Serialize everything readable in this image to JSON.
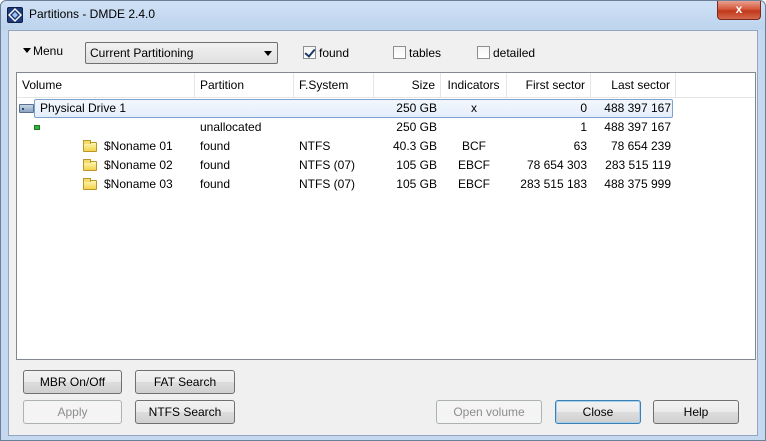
{
  "window": {
    "title": "Partitions - DMDE 2.4.0",
    "close_glyph": "x"
  },
  "toolbar": {
    "menu_label": "Menu",
    "view_select": {
      "selected": "Current Partitioning"
    },
    "checkboxes": [
      {
        "label": "found",
        "checked": true
      },
      {
        "label": "tables",
        "checked": false
      },
      {
        "label": "detailed",
        "checked": false
      }
    ]
  },
  "table": {
    "columns": [
      "Volume",
      "Partition",
      "F.System",
      "Size",
      "Indicators",
      "First sector",
      "Last sector"
    ],
    "rows": [
      {
        "icon": "drive-icon",
        "volume": "Physical Drive 1",
        "partition": "",
        "fs": "",
        "size": "250 GB",
        "indicators": "x",
        "first": "0",
        "last": "488 397 167",
        "selected": true
      },
      {
        "icon": "unallocated-icon",
        "volume": "",
        "partition": "unallocated",
        "fs": "",
        "size": "250 GB",
        "indicators": "",
        "first": "1",
        "last": "488 397 167"
      },
      {
        "icon": "folder-icon",
        "volume": "$Noname 01",
        "partition": "found",
        "fs": "NTFS",
        "size": "40.3 GB",
        "indicators": "BCF",
        "first": "63",
        "last": "78 654 239"
      },
      {
        "icon": "folder-icon",
        "volume": "$Noname 02",
        "partition": "found",
        "fs": "NTFS (07)",
        "size": "105 GB",
        "indicators": "EBCF",
        "first": "78 654 303",
        "last": "283 515 119"
      },
      {
        "icon": "folder-icon",
        "volume": "$Noname 03",
        "partition": "found",
        "fs": "NTFS (07)",
        "size": "105 GB",
        "indicators": "EBCF",
        "first": "283 515 183",
        "last": "488 375 999"
      }
    ]
  },
  "buttons": {
    "mbr": "MBR On/Off",
    "fat_search": "FAT Search",
    "apply": "Apply",
    "ntfs_search": "NTFS Search",
    "open_volume": "Open volume",
    "close": "Close",
    "help": "Help"
  }
}
